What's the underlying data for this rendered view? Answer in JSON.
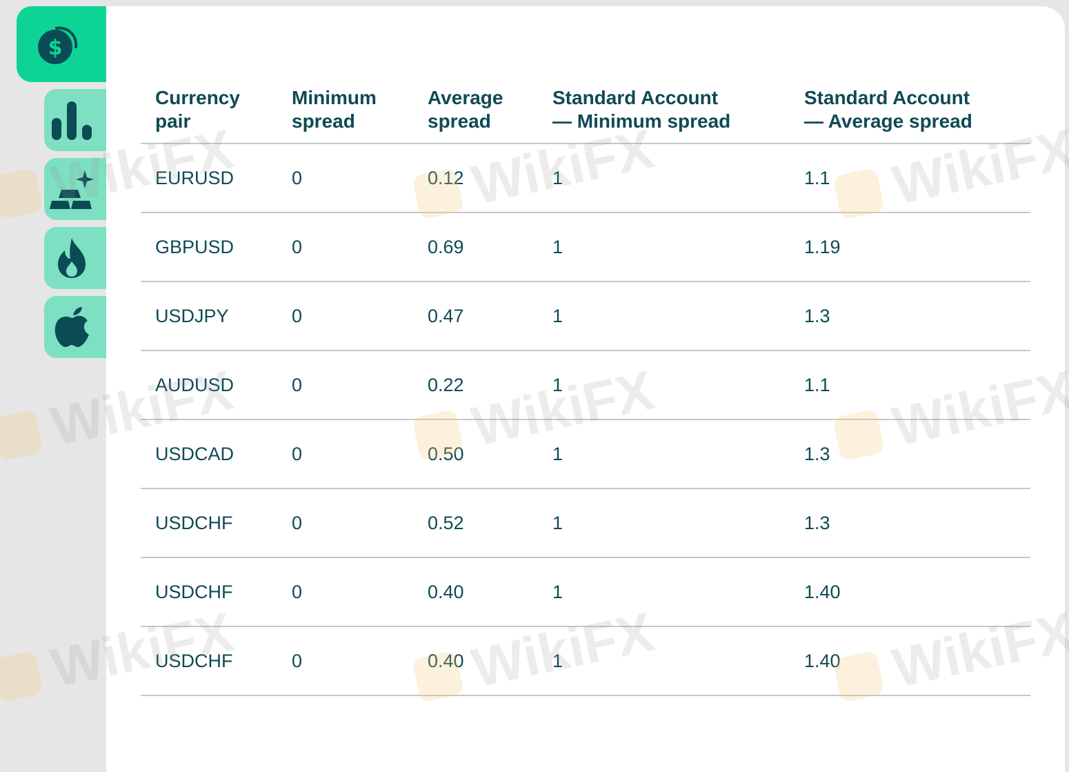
{
  "sidebar": {
    "tabs": [
      {
        "icon": "dollar-coins-icon",
        "active": true
      },
      {
        "icon": "bar-chart-icon",
        "active": false
      },
      {
        "icon": "gold-bars-icon",
        "active": false
      },
      {
        "icon": "flame-icon",
        "active": false
      },
      {
        "icon": "apple-icon",
        "active": false
      }
    ]
  },
  "table": {
    "headers": [
      [
        "Currency",
        "pair"
      ],
      [
        "Minimum",
        "spread"
      ],
      [
        "Average",
        "spread"
      ],
      [
        "Standard Account",
        "— Minimum spread"
      ],
      [
        "Standard Account",
        "— Average spread"
      ]
    ],
    "rows": [
      [
        "EURUSD",
        "0",
        "0.12",
        "1",
        "1.1"
      ],
      [
        "GBPUSD",
        "0",
        "0.69",
        "1",
        "1.19"
      ],
      [
        "USDJPY",
        "0",
        "0.47",
        "1",
        "1.3"
      ],
      [
        "AUDUSD",
        "0",
        "0.22",
        "1",
        "1.1"
      ],
      [
        "USDCAD",
        "0",
        "0.50",
        "1",
        "1.3"
      ],
      [
        "USDCHF",
        "0",
        "0.52",
        "1",
        "1.3"
      ],
      [
        "USDCHF",
        "0",
        "0.40",
        "1",
        "1.40"
      ],
      [
        "USDCHF",
        "0",
        "0.40",
        "1",
        "1.40"
      ]
    ]
  },
  "watermark": {
    "text": "WikiFX"
  },
  "colors": {
    "active_tab": "#0dd495",
    "inactive_tab": "#7ee0c2",
    "icon": "#0b4b55",
    "text": "#0f4a55",
    "divider": "#c4c8ca"
  }
}
